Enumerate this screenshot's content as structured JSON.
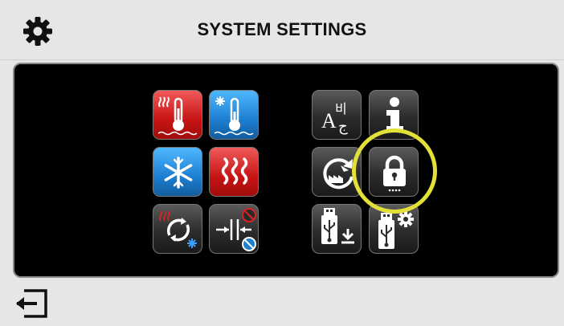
{
  "header": {
    "title": "SYSTEM SETTINGS",
    "icon": "gear-icon"
  },
  "colors": {
    "highlight": "#e3e03a",
    "red_tile": "#c81414",
    "blue_tile": "#1d7fd1",
    "dark_tile": "#2c2c2c"
  },
  "tiles": [
    {
      "name": "heating-temperature-button",
      "icon": "thermometer-heat-icon"
    },
    {
      "name": "cooling-temperature-button",
      "icon": "thermometer-snowflake-icon"
    },
    {
      "name": "cooling-mode-button",
      "icon": "snowflake-icon"
    },
    {
      "name": "heating-mode-button",
      "icon": "heat-waves-icon"
    },
    {
      "name": "auto-changeover-button",
      "icon": "heat-cool-cycle-icon"
    },
    {
      "name": "deadband-button",
      "icon": "deadband-icon"
    },
    {
      "name": "language-button",
      "icon": "language-icon"
    },
    {
      "name": "info-button",
      "icon": "info-icon"
    },
    {
      "name": "factory-reset-button",
      "icon": "factory-reset-icon"
    },
    {
      "name": "lock-button",
      "icon": "lock-icon",
      "highlighted": true
    },
    {
      "name": "usb-download-button",
      "icon": "usb-download-icon"
    },
    {
      "name": "usb-update-button",
      "icon": "usb-settings-icon"
    }
  ],
  "language_tile_glyphs": {
    "latin": "A",
    "hangul": "비",
    "arabic": "ج"
  },
  "footer": {
    "icon": "exit-icon"
  }
}
